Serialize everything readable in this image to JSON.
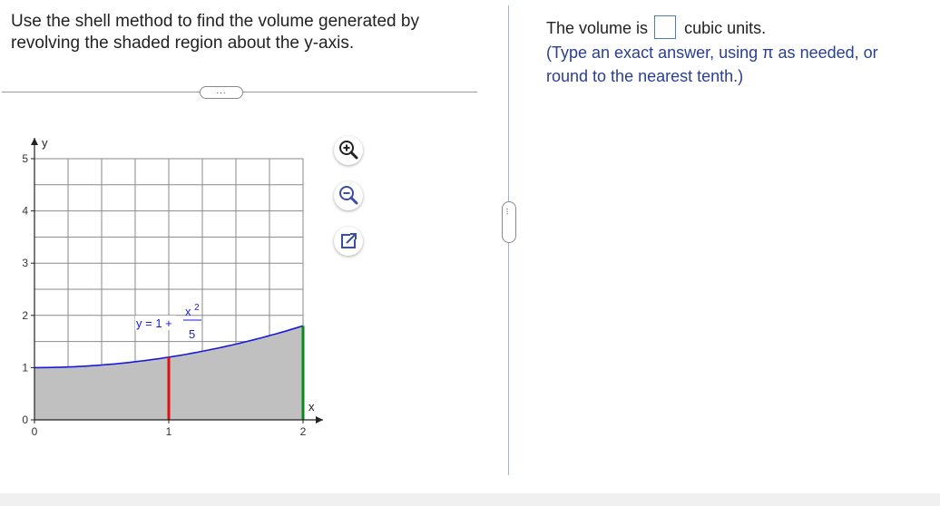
{
  "question": {
    "line1": "Use the shell method to find the volume generated by",
    "line2": "revolving the shaded region about the y-axis."
  },
  "more_button": "...",
  "splitter_handle": "...",
  "answer": {
    "prefix": "The volume is",
    "suffix": "cubic units.",
    "input_value": "",
    "hint_line1": "(Type an exact answer, using π as needed, or",
    "hint_line2": "round to the nearest tenth.)"
  },
  "graph": {
    "y_axis_label": "y",
    "x_axis_label": "x",
    "x_tick_labels": [
      "0",
      "1",
      "2"
    ],
    "y_tick_labels": [
      "0",
      "1",
      "2",
      "3",
      "4",
      "5"
    ],
    "equation": {
      "lhs": "y = 1 +",
      "num": "x",
      "num_exp": "2",
      "den": "5"
    }
  },
  "chart_data": {
    "type": "area",
    "title": "",
    "xlabel": "x",
    "ylabel": "y",
    "xlim": [
      0,
      2.4
    ],
    "ylim": [
      0,
      5
    ],
    "x_ticks": [
      0,
      1,
      2
    ],
    "y_ticks": [
      0,
      1,
      2,
      3,
      4,
      5
    ],
    "grid": true,
    "curve": "y = 1 + x^2/5",
    "x": [
      0,
      0.25,
      0.5,
      0.75,
      1.0,
      1.25,
      1.5,
      1.75,
      2.0
    ],
    "y": [
      1.0,
      1.0125,
      1.05,
      1.1125,
      1.2,
      1.3125,
      1.45,
      1.6125,
      1.8
    ],
    "shaded_region": {
      "x_from": 0,
      "x_to": 2,
      "y_from": 0,
      "y_to": "1 + x^2/5"
    },
    "markers": [
      {
        "x": 1,
        "y_from": 0,
        "y_to": 1.2,
        "color": "#e01010"
      },
      {
        "x": 2,
        "y_from": 0,
        "y_to": 1.8,
        "color": "#0a8a1a"
      }
    ],
    "colors": {
      "curve": "#1a1adc",
      "fill": "#c0c0c0",
      "grid": "#8a8a8a"
    }
  }
}
